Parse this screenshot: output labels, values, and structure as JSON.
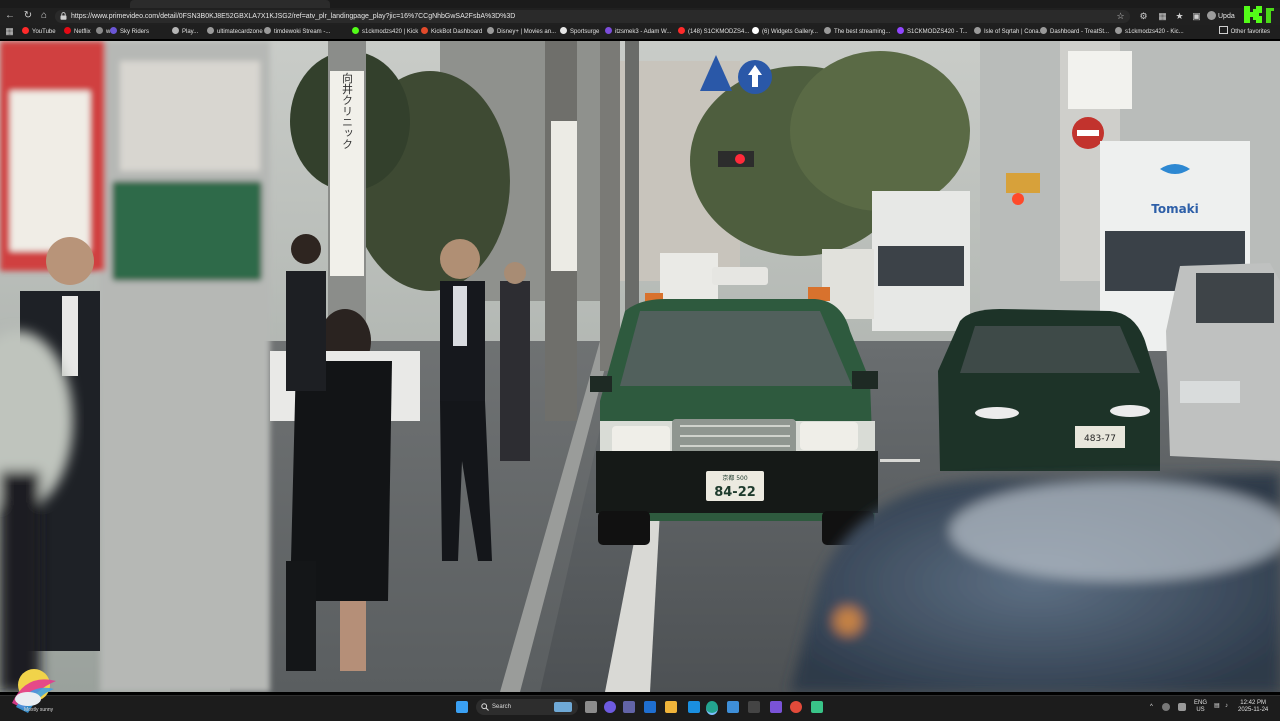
{
  "browser": {
    "url": "https://www.primevideo.com/detail/0FSN3B0KJ8E52GBXLA7X1KJSG2/ref=atv_plr_landingpage_play?jic=16%7CCgNhbGwSA2FsbA%3D%3D",
    "update_label": "Upda",
    "other_favorites": "Other favorites"
  },
  "bookmarks": [
    {
      "label": "YouTube",
      "color": "#ff2a2a"
    },
    {
      "label": "Netflix",
      "color": "#e50914"
    },
    {
      "label": "w",
      "color": "#8a8a8a"
    },
    {
      "label": "Sky Riders",
      "color": "#6b56d6"
    },
    {
      "label": "Play...",
      "color": "#b5b5b5"
    },
    {
      "label": "ultimatecardzone ...",
      "color": "#9a9a9a"
    },
    {
      "label": "timdewoki Stream -...",
      "color": "#9a9a9a"
    },
    {
      "label": "s1ckmodzs420 | Kick",
      "color": "#53fc18"
    },
    {
      "label": "KickBot Dashboard",
      "color": "#e24a2b"
    },
    {
      "label": "Disney+ | Movies an...",
      "color": "#9a9a9a"
    },
    {
      "label": "Sportsurge",
      "color": "#e6e6e6"
    },
    {
      "label": "itzsmek3 - Adam W...",
      "color": "#7c4ddb"
    },
    {
      "label": "(148) S1CKMODZS4...",
      "color": "#ff2a2a"
    },
    {
      "label": "(6) Widgets Gallery...",
      "color": "#ffffff"
    },
    {
      "label": "The best streaming...",
      "color": "#9a9a9a"
    },
    {
      "label": "S1CKMODZS420 - T...",
      "color": "#9146ff"
    },
    {
      "label": "Isle of Sqrtah | Cona...",
      "color": "#9a9a9a"
    },
    {
      "label": "Dashboard - TreatSt...",
      "color": "#9a9a9a"
    },
    {
      "label": "s1ckmodzs420 - Kic...",
      "color": "#9a9a9a"
    }
  ],
  "video": {
    "taxi_plate": "84-22",
    "taxi_plate_small": "京都 500",
    "car_plate": "483-77",
    "sign_clinic": "向井クリニック",
    "truck_brand": "Tomaki"
  },
  "taskbar": {
    "weather": "Mostly sunny",
    "search_placeholder": "Search",
    "lang_top": "ENG",
    "lang_bottom": "US",
    "time": "12:42 PM",
    "date": "2025-11-24"
  },
  "colors": {
    "taxi_body": "#2e5a3e",
    "kick_green": "#53fc18"
  }
}
